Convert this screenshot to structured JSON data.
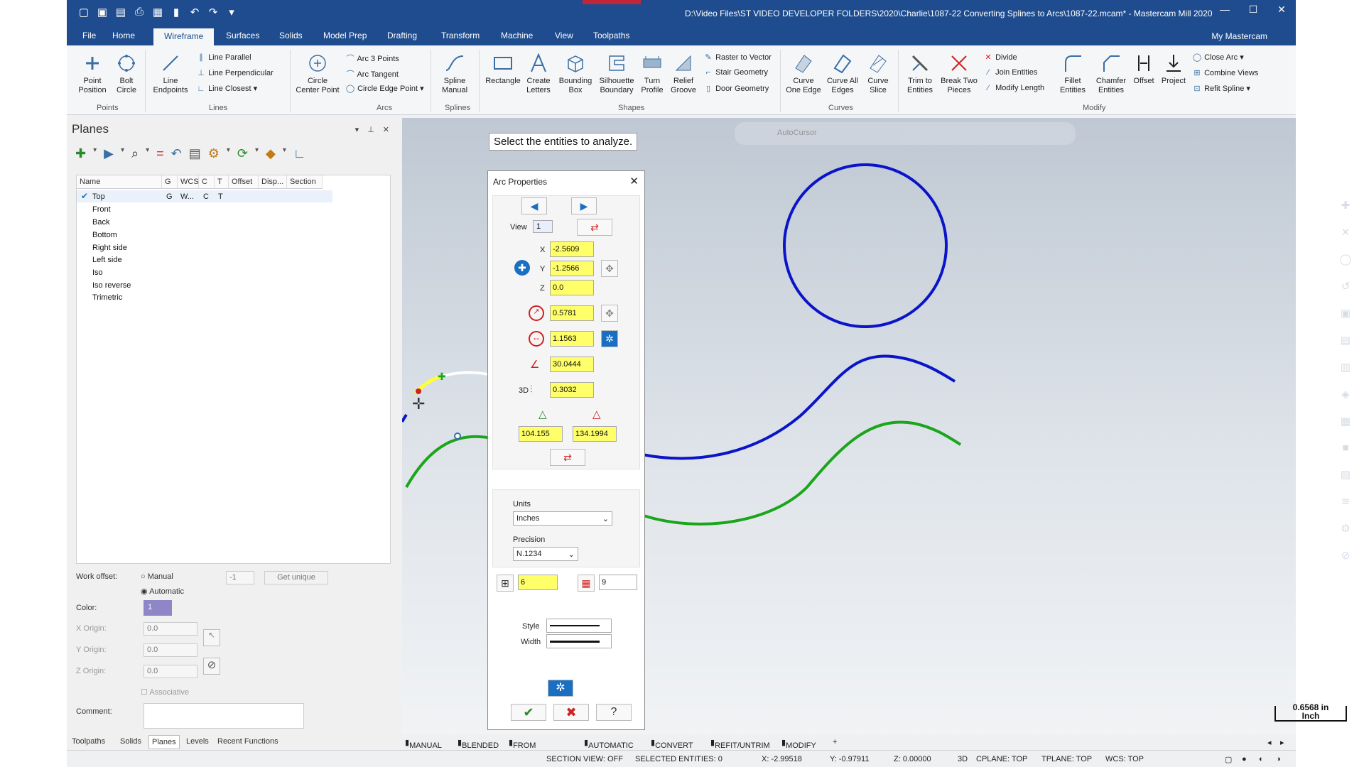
{
  "title": "D:\\Video Files\\ST VIDEO DEVELOPER FOLDERS\\2020\\Charlie\\1087-22 Converting Splines to Arcs\\1087-22.mcam* - Mastercam Mill 2020",
  "menu_tabs": [
    "File",
    "Home",
    "Wireframe",
    "Surfaces",
    "Solids",
    "Model Prep",
    "Drafting",
    "Transform",
    "Machine",
    "View",
    "Toolpaths"
  ],
  "my_mastercam": "My Mastercam",
  "ribbon": {
    "point_position": "Point\nPosition",
    "bolt_circle": "Bolt\nCircle",
    "line_endpoints": "Line\nEndpoints",
    "line_parallel": "Line Parallel",
    "line_perpendicular": "Line Perpendicular",
    "line_closest": "Line Closest",
    "circle_center_point": "Circle\nCenter Point",
    "arc_3_points": "Arc 3 Points",
    "arc_tangent": "Arc Tangent",
    "circle_edge_point": "Circle Edge Point",
    "spline_manual": "Spline\nManual",
    "rectangle": "Rectangle",
    "create_letters": "Create\nLetters",
    "bounding_box": "Bounding\nBox",
    "silhouette_boundary": "Silhouette\nBoundary",
    "turn_profile": "Turn\nProfile",
    "relief_groove": "Relief\nGroove",
    "raster_to_vector": "Raster to Vector",
    "stair_geometry": "Stair Geometry",
    "door_geometry": "Door Geometry",
    "curve_one_edge": "Curve\nOne Edge",
    "curve_all_edges": "Curve All\nEdges",
    "curve_slice": "Curve\nSlice",
    "trim_to_entities": "Trim to\nEntities",
    "break_two_pieces": "Break Two\nPieces",
    "divide": "Divide",
    "join_entities": "Join Entities",
    "modify_length": "Modify Length",
    "fillet_entities": "Fillet\nEntities",
    "chamfer_entities": "Chamfer\nEntities",
    "offset": "Offset",
    "project": "Project",
    "close_arc": "Close Arc",
    "combine_views": "Combine Views",
    "refit_spline": "Refit Spline",
    "groups": {
      "points": "Points",
      "lines": "Lines",
      "arcs": "Arcs",
      "splines": "Splines",
      "shapes": "Shapes",
      "curves": "Curves",
      "modify": "Modify"
    }
  },
  "planes_panel": {
    "title": "Planes",
    "columns": [
      "Name",
      "G",
      "WCS",
      "C",
      "T",
      "Offset",
      "Disp...",
      "Section"
    ],
    "rows": [
      {
        "name": "Top",
        "g": "G",
        "wcs": "W...",
        "c": "C",
        "t": "T"
      },
      {
        "name": "Front"
      },
      {
        "name": "Back"
      },
      {
        "name": "Bottom"
      },
      {
        "name": "Right side"
      },
      {
        "name": "Left side"
      },
      {
        "name": "Iso"
      },
      {
        "name": "Iso reverse"
      },
      {
        "name": "Trimetric"
      }
    ],
    "work_offset_label": "Work offset:",
    "manual": "Manual",
    "automatic": "Automatic",
    "offset_value": "-1",
    "get_unique": "Get unique",
    "color_label": "Color:",
    "color_value": "1",
    "x_origin_label": "X Origin:",
    "y_origin_label": "Y Origin:",
    "z_origin_label": "Z Origin:",
    "x_origin": "0.0",
    "y_origin": "0.0",
    "z_origin": "0.0",
    "associative": "Associative",
    "comment_label": "Comment:"
  },
  "bottom_tabs": [
    "Toolpaths",
    "Solids",
    "Planes",
    "Levels",
    "Recent Functions"
  ],
  "prompt": "Select the entities to analyze.",
  "autocursor": "AutoCursor",
  "arc_dialog": {
    "title": "Arc Properties",
    "view_label": "View",
    "view_value": "1",
    "x_label": "X",
    "x": "-2.5609",
    "y_label": "Y",
    "y": "-1.2566",
    "z_label": "Z",
    "z": "0.0",
    "radius": "0.5781",
    "diameter": "1.1563",
    "sweep": "30.0444",
    "length_3d_label": "3D",
    "length_3d": "0.3032",
    "start_angle": "104.155",
    "end_angle": "134.1994",
    "units_label": "Units",
    "units": "Inches",
    "precision_label": "Precision",
    "precision": "N.1234",
    "level": "6",
    "color": "9",
    "style_label": "Style",
    "width_label": "Width"
  },
  "scale": {
    "value": "0.6568 in",
    "unit": "Inch"
  },
  "operations": [
    "MANUAL",
    "BLENDED",
    "FROM CURVES",
    "AUTOMATIC",
    "CONVERT",
    "REFIT/UNTRIM",
    "MODIFY"
  ],
  "status": {
    "section_view": "SECTION VIEW: OFF",
    "selected": "SELECTED ENTITIES: 0",
    "x": "X:  -2.99518",
    "y": "Y:  -0.97911",
    "z": "Z:  0.00000",
    "mode": "3D",
    "cplane": "CPLANE: TOP",
    "tplane": "TPLANE: TOP",
    "wcs": "WCS: TOP"
  },
  "colors": {
    "titlebar": "#1e4c8e",
    "blue_geom": "#0a14c8",
    "green_geom": "#1aa51a",
    "highlight": "#ffff6a"
  }
}
